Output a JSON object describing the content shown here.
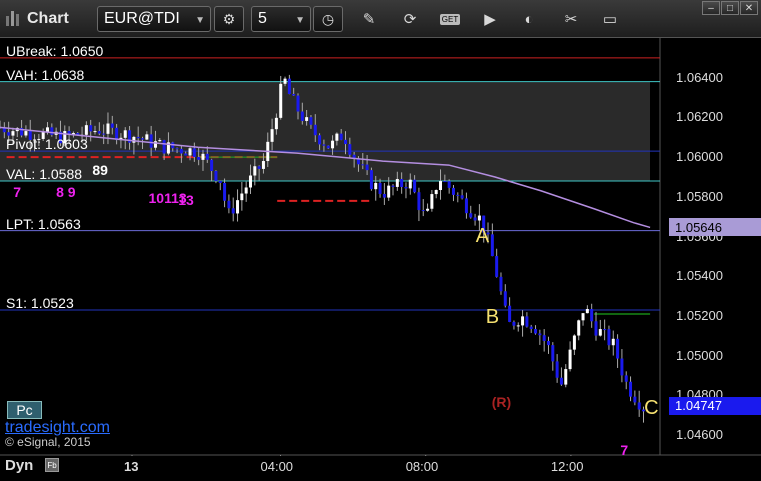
{
  "app": {
    "title": "Chart"
  },
  "toolbar": {
    "symbol": "EUR@TDI",
    "interval": "5",
    "icons": [
      "gear-icon",
      "clock-icon",
      "pencil-icon",
      "refresh-icon",
      "get-icon",
      "play-icon",
      "tools-icon",
      "note-icon"
    ],
    "get_label": "GET"
  },
  "levels": [
    {
      "label": "UBreak: 1.0650",
      "price": 1.065,
      "color": "#cc2222"
    },
    {
      "label": "VAH: 1.0638",
      "price": 1.0638,
      "color": "#3fc6c6"
    },
    {
      "label": "Pivot: 1.0603",
      "price": 1.0603,
      "color": "#2233bb"
    },
    {
      "label": "VAL: 1.0588",
      "price": 1.0588,
      "color": "#3fc6c6"
    },
    {
      "label": "LPT: 1.0563",
      "price": 1.0563,
      "color": "#6b6bd8"
    },
    {
      "label": "S1: 1.0523",
      "price": 1.0523,
      "color": "#2233bb"
    }
  ],
  "y_axis": {
    "min": 1.045,
    "max": 1.066,
    "ticks": [
      "1.06400",
      "1.06200",
      "1.06000",
      "1.05800",
      "1.05600",
      "1.05400",
      "1.05200",
      "1.05000",
      "1.04800",
      "1.04600"
    ]
  },
  "x_axis": {
    "ticks": [
      {
        "label": "13",
        "pos": 0.2
      },
      {
        "label": "04:00",
        "pos": 0.425
      },
      {
        "label": "08:00",
        "pos": 0.645
      },
      {
        "label": "12:00",
        "pos": 0.865
      }
    ]
  },
  "price_tags": [
    {
      "label": "1.05646",
      "price": 1.05646,
      "bg": "#a99bd6",
      "fg": "#000000"
    },
    {
      "label": "1.04747",
      "price": 1.04747,
      "bg": "#1a1aee",
      "fg": "#ffffff"
    }
  ],
  "letters": [
    {
      "text": "A",
      "pos": 0.73,
      "price": 1.056
    },
    {
      "text": "B",
      "pos": 0.745,
      "price": 1.0519
    },
    {
      "text": "C",
      "pos": 0.985,
      "price": 1.0473
    }
  ],
  "annotations": [
    {
      "text": "89",
      "pos": 0.14,
      "price": 1.0593,
      "color": "#ffffff"
    },
    {
      "text": "8 9",
      "pos": 0.085,
      "price": 1.0582,
      "color": "#ee22ee"
    },
    {
      "text": "7",
      "pos": 0.02,
      "price": 1.0582,
      "color": "#ee22ee"
    },
    {
      "text": "10113",
      "pos": 0.225,
      "price": 1.0579,
      "color": "#ee22ee"
    },
    {
      "text": "13",
      "pos": 0.27,
      "price": 1.0578,
      "color": "#ee22ee"
    },
    {
      "text": "(R)",
      "pos": 0.745,
      "price": 1.0476,
      "color": "#aa2222"
    },
    {
      "text": "7",
      "pos": 0.94,
      "price": 1.0452,
      "color": "#ee22ee"
    }
  ],
  "footer": {
    "badge": "Pc",
    "site": "tradesight.com",
    "copyright": "© eSignal, 2015",
    "dyn": "Dyn",
    "dyn_icon": "Fb"
  },
  "chart_data": {
    "type": "candlestick",
    "symbol": "EUR@TDI",
    "interval": "5",
    "ylim": [
      1.045,
      1.066
    ],
    "x_ticks": [
      "13",
      "04:00",
      "08:00",
      "12:00"
    ],
    "y_ticks": [
      1.064,
      1.062,
      1.06,
      1.058,
      1.056,
      1.054,
      1.052,
      1.05,
      1.048,
      1.046
    ],
    "close_path": [
      [
        0.0,
        1.0615
      ],
      [
        0.05,
        1.0612
      ],
      [
        0.1,
        1.061
      ],
      [
        0.15,
        1.0614
      ],
      [
        0.2,
        1.0611
      ],
      [
        0.25,
        1.0605
      ],
      [
        0.3,
        1.0603
      ],
      [
        0.335,
        1.0588
      ],
      [
        0.345,
        1.057
      ],
      [
        0.37,
        1.0584
      ],
      [
        0.4,
        1.0598
      ],
      [
        0.42,
        1.0625
      ],
      [
        0.43,
        1.064
      ],
      [
        0.44,
        1.063
      ],
      [
        0.47,
        1.0614
      ],
      [
        0.5,
        1.0605
      ],
      [
        0.52,
        1.0612
      ],
      [
        0.54,
        1.0598
      ],
      [
        0.56,
        1.0588
      ],
      [
        0.58,
        1.0582
      ],
      [
        0.62,
        1.0588
      ],
      [
        0.645,
        1.0568
      ],
      [
        0.665,
        1.059
      ],
      [
        0.68,
        1.0585
      ],
      [
        0.7,
        1.0578
      ],
      [
        0.73,
        1.0568
      ],
      [
        0.75,
        1.0545
      ],
      [
        0.77,
        1.0515
      ],
      [
        0.79,
        1.052
      ],
      [
        0.81,
        1.0515
      ],
      [
        0.83,
        1.0505
      ],
      [
        0.85,
        1.0485
      ],
      [
        0.87,
        1.0508
      ],
      [
        0.885,
        1.0525
      ],
      [
        0.9,
        1.0515
      ],
      [
        0.93,
        1.0505
      ],
      [
        0.95,
        1.0485
      ],
      [
        0.975,
        1.0474
      ]
    ],
    "moving_average": [
      [
        0.0,
        1.0615
      ],
      [
        0.3,
        1.0605
      ],
      [
        0.45,
        1.0602
      ],
      [
        0.58,
        1.0598
      ],
      [
        0.68,
        1.0596
      ],
      [
        0.75,
        1.059
      ],
      [
        0.82,
        1.0583
      ],
      [
        0.9,
        1.0574
      ],
      [
        0.96,
        1.0567
      ],
      [
        0.985,
        1.05646
      ]
    ],
    "last_price": 1.04747,
    "ma_last": 1.05646
  }
}
